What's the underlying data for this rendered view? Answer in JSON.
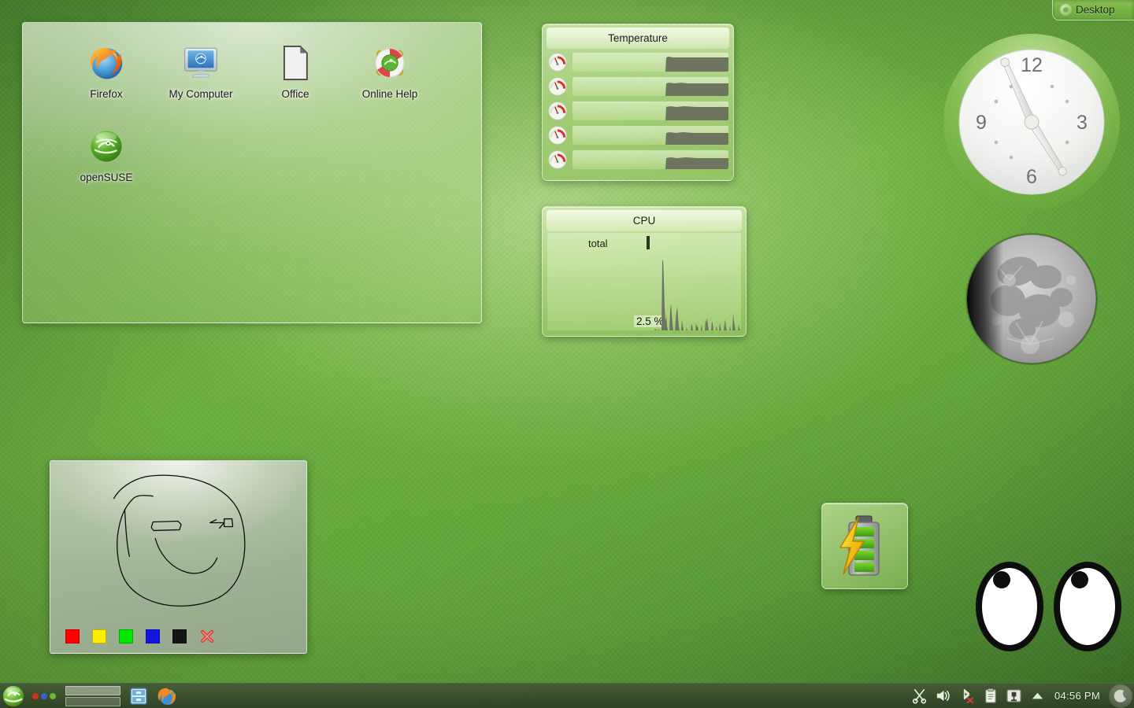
{
  "desktop": {
    "wallpaper_accent": "#6aad3e",
    "activity_toolbox": {
      "label": "Desktop",
      "icon": "cashew-icon"
    }
  },
  "folder_view": {
    "items": [
      {
        "label": "Firefox",
        "icon": "firefox-icon"
      },
      {
        "label": "My Computer",
        "icon": "my-computer-icon"
      },
      {
        "label": "Office",
        "icon": "office-document-icon"
      },
      {
        "label": "Online Help",
        "icon": "online-help-lifering-icon"
      },
      {
        "label": "openSUSE",
        "icon": "opensuse-geeko-icon"
      }
    ]
  },
  "temperature_widget": {
    "title": "Temperature",
    "sensor_icon": "thermometer-gauge-icon",
    "rows": [
      {
        "index": 1,
        "icon": "gauge-icon"
      },
      {
        "index": 2,
        "icon": "gauge-icon"
      },
      {
        "index": 3,
        "icon": "gauge-icon"
      },
      {
        "index": 4,
        "icon": "gauge-icon"
      },
      {
        "index": 5,
        "icon": "gauge-icon"
      }
    ]
  },
  "cpu_widget": {
    "title": "CPU",
    "legend_label": "total",
    "value": "2.5 %"
  },
  "clock_widget": {
    "hour_labels": [
      "12",
      "3",
      "6",
      "9"
    ],
    "time": "04:56",
    "hour_hand_deg": 148,
    "minute_hand_deg": 336
  },
  "moon_widget": {
    "name": "moon-phase-icon",
    "phase": "waxing-gibbous"
  },
  "eyes_widget": {
    "name": "eyes-widget",
    "eye_count": 2
  },
  "battery_widget": {
    "name": "battery-charging-icon",
    "segments": 4
  },
  "paint_widget": {
    "name": "paint-notes-widget",
    "drawing": "hand-drawn-smiley-face",
    "palette": [
      {
        "name": "red",
        "color": "#ff0000"
      },
      {
        "name": "yellow",
        "color": "#ffee00"
      },
      {
        "name": "green",
        "color": "#00e800"
      },
      {
        "name": "blue",
        "color": "#1414e0"
      },
      {
        "name": "black",
        "color": "#141414"
      }
    ],
    "clear_label": "clear-x-icon"
  },
  "taskbar": {
    "menu_button": "opensuse-kickoff-icon",
    "activity_dots": [
      {
        "color": "#cc3322"
      },
      {
        "color": "#3366cc"
      },
      {
        "color": "#66bb33"
      }
    ],
    "pager": {
      "name": "pager",
      "desktops": 2,
      "active": 1
    },
    "launchers": [
      {
        "label": "File Manager",
        "icon": "file-manager-icon"
      },
      {
        "label": "Firefox",
        "icon": "firefox-icon"
      }
    ],
    "tray": [
      {
        "label": "Klipper",
        "icon": "scissors-icon"
      },
      {
        "label": "Volume",
        "icon": "speaker-icon"
      },
      {
        "label": "Bluetooth",
        "icon": "bluetooth-disabled-icon"
      },
      {
        "label": "Clipboard",
        "icon": "clipboard-icon"
      },
      {
        "label": "Device Notifier",
        "icon": "device-notifier-icon"
      },
      {
        "label": "Show hidden",
        "icon": "arrow-up-icon"
      }
    ],
    "clock": "04:56 PM",
    "night_icon": "moon-tray-icon"
  }
}
